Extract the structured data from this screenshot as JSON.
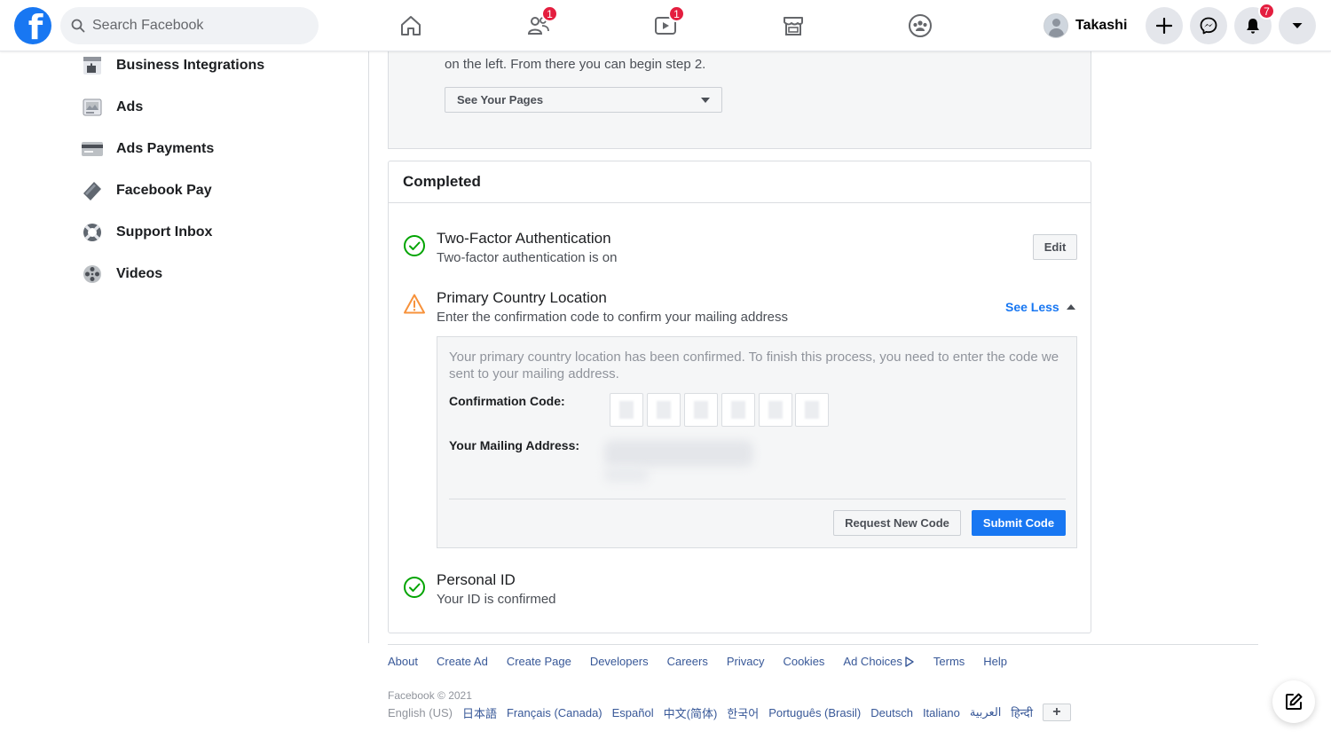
{
  "topbar": {
    "logo": "f",
    "search_placeholder": "Search Facebook",
    "nav_icons": [
      "home-icon",
      "friends-icon",
      "watch-icon",
      "marketplace-icon",
      "groups-icon"
    ],
    "friends_badge": "1",
    "watch_badge": "1",
    "profile_name": "Takashi",
    "notifications_badge": "7"
  },
  "sidebar": {
    "items": [
      {
        "label": "Business Integrations",
        "icon": "puzzle-icon"
      },
      {
        "label": "Ads",
        "icon": "ads-icon"
      },
      {
        "label": "Ads Payments",
        "icon": "credit-card-icon"
      },
      {
        "label": "Facebook Pay",
        "icon": "payment-tag-icon"
      },
      {
        "label": "Support Inbox",
        "icon": "lifebuoy-icon"
      },
      {
        "label": "Videos",
        "icon": "film-reel-icon"
      }
    ]
  },
  "main": {
    "top_card": {
      "text": "on the left. From there you can begin step 2.",
      "select_label": "See Your Pages"
    },
    "completed": {
      "title": "Completed",
      "two_factor": {
        "title": "Two-Factor Authentication",
        "subtitle": "Two-factor authentication is on",
        "edit_label": "Edit"
      },
      "primary_country": {
        "title": "Primary Country Location",
        "subtitle": "Enter the confirmation code to confirm your mailing address",
        "see_less_label": "See Less",
        "info": "Your primary country location has been confirmed. To finish this process, you need to enter the code we sent to your mailing address.",
        "code_label": "Confirmation Code:",
        "address_label": "Your Mailing Address:",
        "request_label": "Request New Code",
        "submit_label": "Submit Code"
      },
      "personal_id": {
        "title": "Personal ID",
        "subtitle": "Your ID is confirmed"
      }
    }
  },
  "footer": {
    "links": [
      "About",
      "Create Ad",
      "Create Page",
      "Developers",
      "Careers",
      "Privacy",
      "Cookies",
      "Ad Choices",
      "Terms",
      "Help"
    ],
    "copyright": "Facebook © 2021",
    "languages": [
      "English (US)",
      "日本語",
      "Français (Canada)",
      "Español",
      "中文(简体)",
      "한국어",
      "Português (Brasil)",
      "Deutsch",
      "Italiano",
      "العربية",
      "हिन्दी"
    ],
    "lang_more": "+"
  },
  "colors": {
    "brand": "#1877f2",
    "badge": "#e41e3f",
    "success": "#00a400",
    "warning": "#f7923b"
  }
}
